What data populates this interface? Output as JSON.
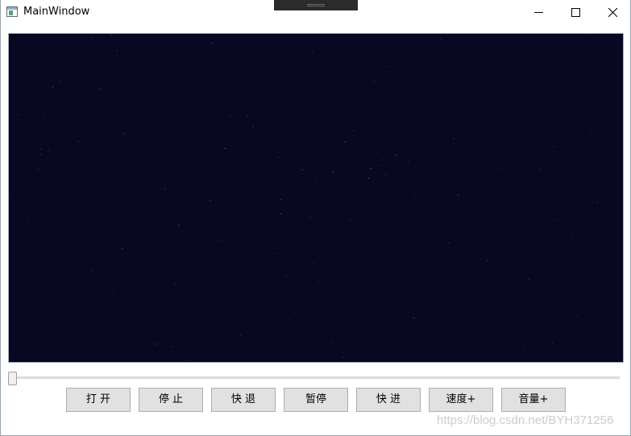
{
  "window": {
    "title": "MainWindow"
  },
  "icons": {
    "app": "window-app-icon",
    "minimize": "minimize-icon",
    "maximize": "maximize-icon",
    "close": "close-icon"
  },
  "player": {
    "background_color": "#090722",
    "progress": 0
  },
  "controls": {
    "open_label": "打 开",
    "stop_label": "停 止",
    "rewind_label": "快 退",
    "pause_label": "暂停",
    "forward_label": "快 进",
    "speed_label": "速度+",
    "volume_label": "音量+"
  },
  "watermark": "https://blog.csdn.net/BYH371256"
}
